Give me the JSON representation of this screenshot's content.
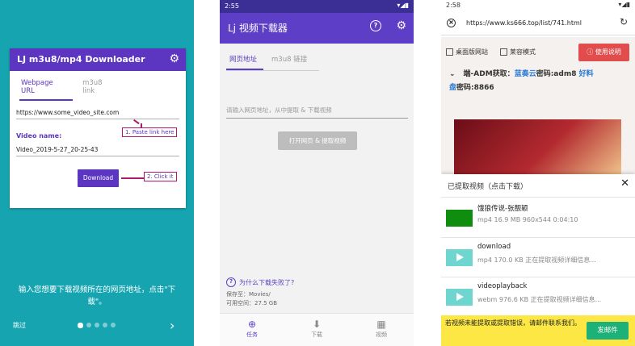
{
  "panel1": {
    "card_title": "LJ m3u8/mp4 Downloader",
    "tabs": [
      "Webpage URL",
      "m3u8 link"
    ],
    "url_value": "https://www.some_video_site.com",
    "video_name_label": "Video name:",
    "video_name_value": "Video_2019-5-27_20-25-43",
    "download_label": "Download",
    "callout1": "1. Paste link here",
    "callout2": "2. Click it",
    "instruction": "输入您想要下载视频所在的网页地址，点击\"下载\"。",
    "skip": "跳过",
    "page_dots": 5,
    "active_dot": 1
  },
  "panel2": {
    "time": "2:55",
    "app_title": "Lj 视频下载器",
    "tabs": [
      "网页地址",
      "m3u8 链接"
    ],
    "input_placeholder": "请输入网页地址，从中提取 & 下载视频",
    "open_button": "打开网页 & 提取视频",
    "faq": "为什么下载失败了?",
    "save_to": "保存至：Movies/",
    "free_space": "可用空间：27.5 GB",
    "nav": [
      "任务",
      "下载",
      "视频"
    ]
  },
  "panel3": {
    "time": "2:58",
    "url": "https://www.ks666.top/list/741.html",
    "desktop_mode": "桌面版网站",
    "incognito": "莱容模式",
    "manual": "使用说明",
    "web_text_a": "端-ADM获取：",
    "web_text_link": "蓝奏云",
    "web_text_b": "密码:adm8 ",
    "web_text_c": "好料",
    "web_text_d": "盘",
    "web_text_e": "密码:8866",
    "sheet_title": "已提取视频（点击下载）",
    "videos": [
      {
        "name": "饿狼传说-张靓颖",
        "meta": "mp4  16.9 MB  960x544  0:04:10"
      },
      {
        "name": "download",
        "meta": "mp4  170.0 KB  正在提取视频详细信息..."
      },
      {
        "name": "videoplayback",
        "meta": "webm  976.6 KB  正在提取视频详细信息..."
      }
    ],
    "banner_text": "若视频未能提取或提取错误，请邮件联系我们。",
    "banner_button": "发邮件"
  }
}
